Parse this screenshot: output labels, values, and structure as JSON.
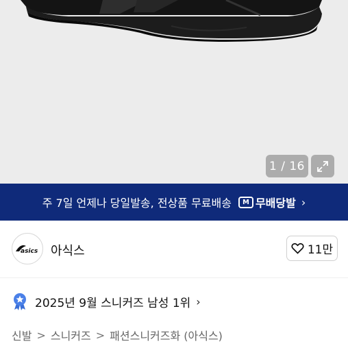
{
  "gallery": {
    "counter": "1 / 16",
    "expand_icon": "expand-icon"
  },
  "shipping_banner": {
    "text": "주 7일 언제나 당일발송, 전상품 무료배송",
    "badge_mark": "M",
    "badge_label": "무배당발",
    "chevron": "›",
    "bg_color": "#0f2a7a"
  },
  "brand": {
    "name": "아식스",
    "logo_text": "asics",
    "like_count": "11만"
  },
  "ranking": {
    "text": "2025년 9월 스니커즈 남성 1위",
    "chevron": "›"
  },
  "breadcrumb": {
    "items": [
      "신발",
      "스니커즈",
      "패션스니커즈화 (아식스)"
    ],
    "separator": ">"
  }
}
